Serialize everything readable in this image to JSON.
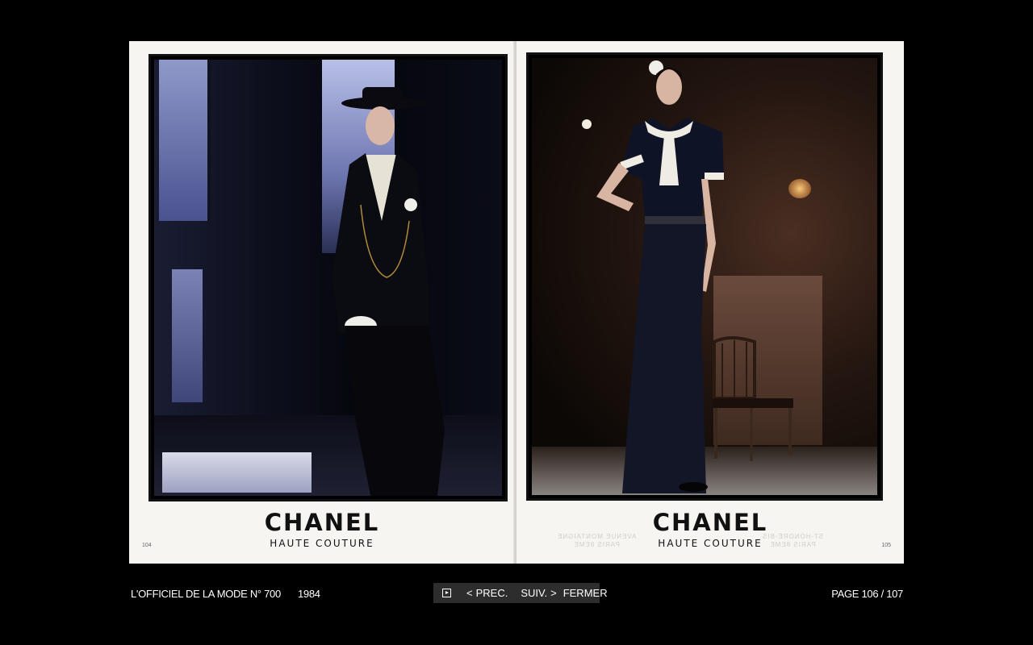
{
  "spread": {
    "left_page": {
      "brand_name": "CHANEL",
      "brand_sub": "HAUTE COUTURE",
      "folio": "104"
    },
    "right_page": {
      "brand_name": "CHANEL",
      "brand_sub": "HAUTE COUTURE",
      "folio": "105",
      "show_through_left": "AVENUE MONTAIGNE\nPARIS 8EME",
      "show_through_right": "ST-HONORÉ-BIS\nPARIS 8EME"
    }
  },
  "footer": {
    "magazine": "L'OFFICIEL DE LA MODE N° 700",
    "year": "1984",
    "page_info": "PAGE 106 / 107"
  },
  "nav": {
    "prev_arrow": "<",
    "prev_label": "PREC.",
    "next_label": "SUIV.",
    "next_arrow": ">",
    "close_label": "FERMER",
    "play_icon": "play-icon"
  },
  "colors": {
    "background": "#000000",
    "nav_bar": "#2d2d2d",
    "page_paper": "#f6f5f2"
  }
}
